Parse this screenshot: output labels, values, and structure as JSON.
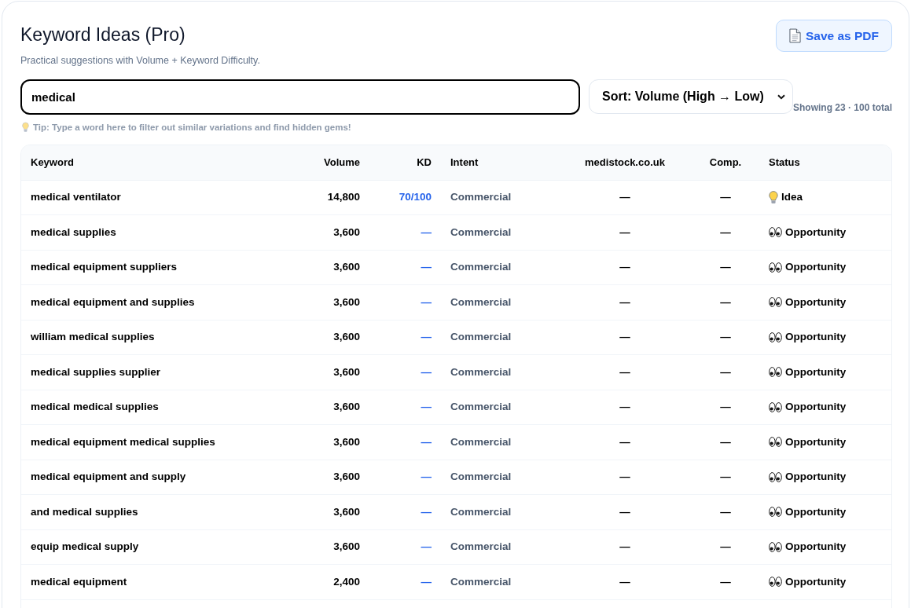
{
  "header": {
    "title": "Keyword Ideas (Pro)",
    "subtitle": "Practical suggestions with Volume + Keyword Difficulty.",
    "save_button": "Save as PDF"
  },
  "search": {
    "value": "medical"
  },
  "sort": {
    "value": "Sort: Volume (High → Low)"
  },
  "summary": "Showing 23 · 100 total",
  "tip": "Tip: Type a word here to filter out similar variations and find hidden gems!",
  "table": {
    "columns": [
      "Keyword",
      "Volume",
      "KD",
      "Intent",
      "medistock.co.uk",
      "Comp.",
      "Status"
    ],
    "rows": [
      {
        "keyword": "medical ventilator",
        "volume": "14,800",
        "kd": "70/100",
        "intent": "Commercial",
        "medistock": "—",
        "comp": "—",
        "status": {
          "kind": "idea",
          "label": "Idea"
        }
      },
      {
        "keyword": "medical supplies",
        "volume": "3,600",
        "kd": "—",
        "intent": "Commercial",
        "medistock": "—",
        "comp": "—",
        "status": {
          "kind": "opportunity",
          "label": "Opportunity"
        }
      },
      {
        "keyword": "medical equipment suppliers",
        "volume": "3,600",
        "kd": "—",
        "intent": "Commercial",
        "medistock": "—",
        "comp": "—",
        "status": {
          "kind": "opportunity",
          "label": "Opportunity"
        }
      },
      {
        "keyword": "medical equipment and supplies",
        "volume": "3,600",
        "kd": "—",
        "intent": "Commercial",
        "medistock": "—",
        "comp": "—",
        "status": {
          "kind": "opportunity",
          "label": "Opportunity"
        }
      },
      {
        "keyword": "william medical supplies",
        "volume": "3,600",
        "kd": "—",
        "intent": "Commercial",
        "medistock": "—",
        "comp": "—",
        "status": {
          "kind": "opportunity",
          "label": "Opportunity"
        }
      },
      {
        "keyword": "medical supplies supplier",
        "volume": "3,600",
        "kd": "—",
        "intent": "Commercial",
        "medistock": "—",
        "comp": "—",
        "status": {
          "kind": "opportunity",
          "label": "Opportunity"
        }
      },
      {
        "keyword": "medical medical supplies",
        "volume": "3,600",
        "kd": "—",
        "intent": "Commercial",
        "medistock": "—",
        "comp": "—",
        "status": {
          "kind": "opportunity",
          "label": "Opportunity"
        }
      },
      {
        "keyword": "medical equipment medical supplies",
        "volume": "3,600",
        "kd": "—",
        "intent": "Commercial",
        "medistock": "—",
        "comp": "—",
        "status": {
          "kind": "opportunity",
          "label": "Opportunity"
        }
      },
      {
        "keyword": "medical equipment and supply",
        "volume": "3,600",
        "kd": "—",
        "intent": "Commercial",
        "medistock": "—",
        "comp": "—",
        "status": {
          "kind": "opportunity",
          "label": "Opportunity"
        }
      },
      {
        "keyword": "and medical supplies",
        "volume": "3,600",
        "kd": "—",
        "intent": "Commercial",
        "medistock": "—",
        "comp": "—",
        "status": {
          "kind": "opportunity",
          "label": "Opportunity"
        }
      },
      {
        "keyword": "equip medical supply",
        "volume": "3,600",
        "kd": "—",
        "intent": "Commercial",
        "medistock": "—",
        "comp": "—",
        "status": {
          "kind": "opportunity",
          "label": "Opportunity"
        }
      },
      {
        "keyword": "medical equipment",
        "volume": "2,400",
        "kd": "—",
        "intent": "Commercial",
        "medistock": "—",
        "comp": "—",
        "status": {
          "kind": "opportunity",
          "label": "Opportunity"
        }
      }
    ]
  }
}
